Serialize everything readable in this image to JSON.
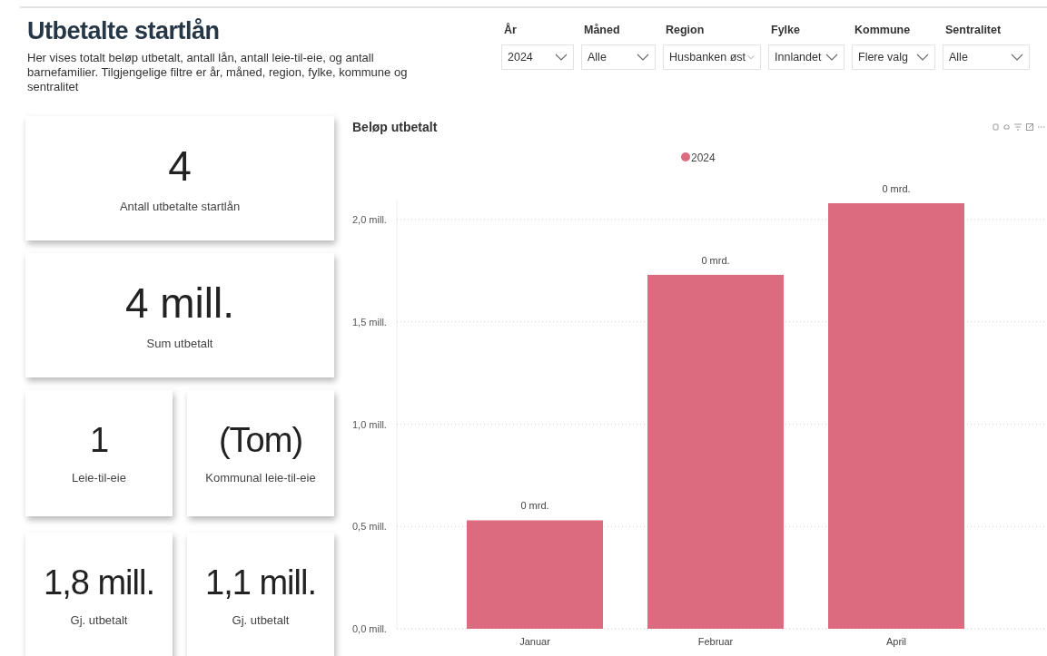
{
  "header": {
    "title": "Utbetalte startlån",
    "description": "Her vises totalt beløp utbetalt, antall lån, antall leie-til-eie, og antall barnefamilier. Tilgjengelige filtre er år, måned, region, fylke, kommune og sentralitet"
  },
  "filters": [
    {
      "label": "År",
      "value": "2024"
    },
    {
      "label": "Måned",
      "value": "Alle"
    },
    {
      "label": "Region",
      "value": "Husbanken øst"
    },
    {
      "label": "Fylke",
      "value": "Innlandet"
    },
    {
      "label": "Kommune",
      "value": "Flere valg"
    },
    {
      "label": "Sentralitet",
      "value": "Alle"
    }
  ],
  "wide_kpis": [
    {
      "value": "4",
      "label": "Antall utbetalte startlån"
    },
    {
      "value": "4 mill.",
      "label": "Sum utbetalt"
    }
  ],
  "small_kpis": [
    {
      "value": "1",
      "label": "Leie-til-eie"
    },
    {
      "value": "(Tom)",
      "label": "Kommunal leie-til-eie"
    },
    {
      "value": "1,8 mill.",
      "label": "Gj. utbetalt"
    },
    {
      "value": "1,1 mill.",
      "label": "Gj. utbetalt"
    }
  ],
  "chart": {
    "title": "Beløp utbetalt",
    "chart_data": {
      "type": "bar",
      "categories": [
        "Januar",
        "Februar",
        "April"
      ],
      "series": [
        {
          "name": "2024",
          "color": "#dd6b7f",
          "values": [
            0.53,
            1.73,
            2.08
          ]
        }
      ],
      "ylim": [
        0,
        2.1
      ],
      "grid": true,
      "yticks": [
        {
          "value": 0,
          "label": "0,0 mill."
        },
        {
          "value": 0.5,
          "label": "0,5 mill."
        },
        {
          "value": 1,
          "label": "1,0 mill."
        },
        {
          "value": 1.5,
          "label": "1,5 mill."
        },
        {
          "value": 2,
          "label": "2,0 mill."
        }
      ],
      "value_labels": [
        "0 mrd.",
        "0 mrd.",
        "0 mrd."
      ]
    }
  }
}
